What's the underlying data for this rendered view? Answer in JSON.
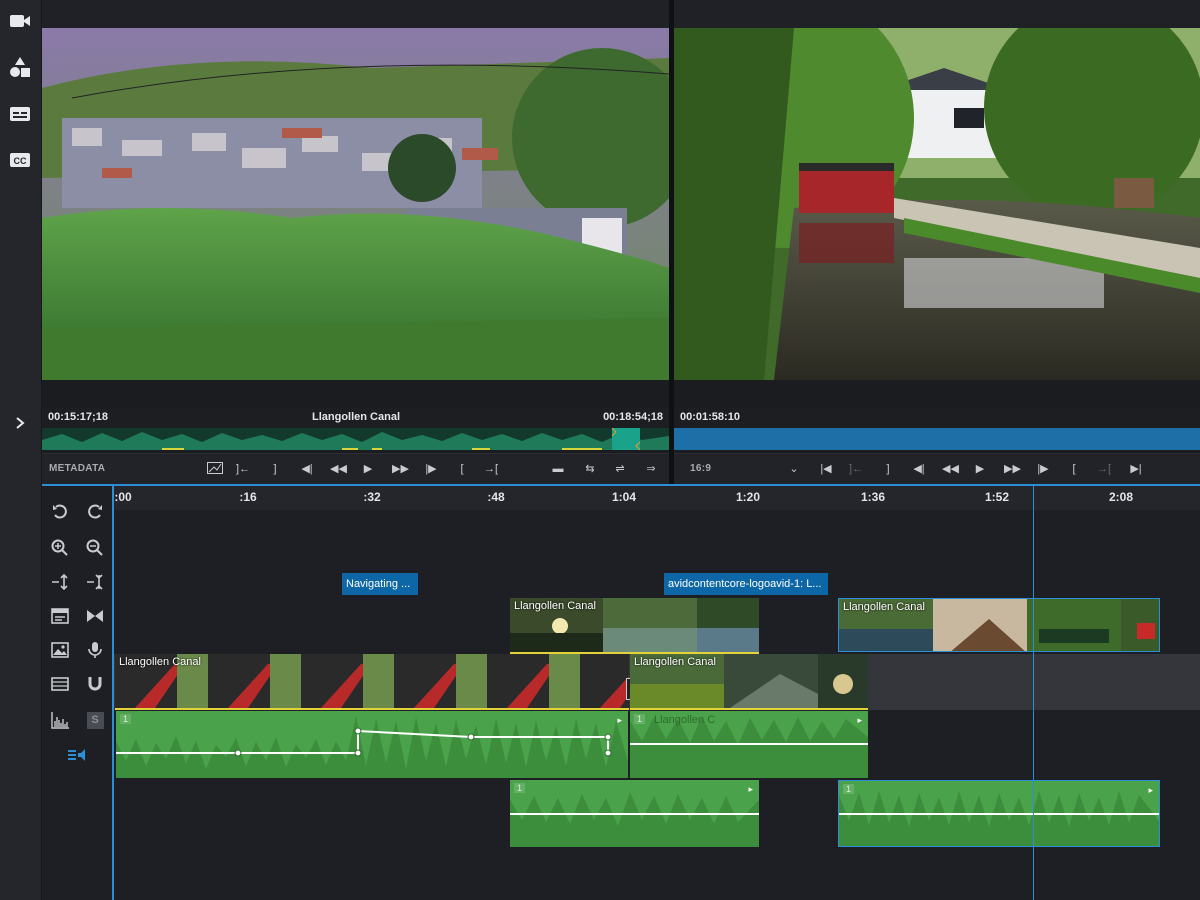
{
  "source_viewer": {
    "timecode_in": "00:15:17;18",
    "clip_name": "Llangollen Canal",
    "timecode_out": "00:18:54;18",
    "metadata_label": "METADATA"
  },
  "record_viewer": {
    "timecode": "00:01:58:10",
    "aspect": "16:9"
  },
  "ruler": {
    "ticks": [
      ":00",
      ":16",
      ":32",
      ":48",
      "1:04",
      "1:20",
      "1:36",
      "1:52",
      "2:08"
    ]
  },
  "markers": [
    {
      "label": "Navigating ..."
    },
    {
      "label": "avidcontentcore-logoavid-1: L..."
    }
  ],
  "video_clips": {
    "v2_a": "Llangollen Canal",
    "v2_b": "Llangollen Canal",
    "v1_a": "Llangollen Canal",
    "v1_b": "Llangollen Canal"
  },
  "audio_clips": {
    "a1_a_num": "1",
    "a1_b_num": "1",
    "a1_b_title": "Llangollen C",
    "a2_a_num": "1",
    "a2_b_num": "1"
  },
  "tools": {
    "solo_label": "S"
  },
  "colors": {
    "accent_blue": "#2b8fd6",
    "marker_blue": "#0d67a6",
    "audio_green": "#4aa34a",
    "clip_yellow": "#e3d23a",
    "record_bar": "#1e6fa8"
  },
  "icons": [
    "video-icon",
    "shapes-icon",
    "subtitle-icon",
    "cc-icon",
    "chevron-right-icon",
    "undo-icon",
    "redo-icon",
    "zoom-in-icon",
    "zoom-out-icon",
    "expand-icon",
    "collapse-icon",
    "title-icon",
    "bowtie-icon",
    "image-icon",
    "mic-icon",
    "film-icon",
    "magnet-icon",
    "waveform-icon",
    "solo-icon",
    "audio-list-icon"
  ]
}
